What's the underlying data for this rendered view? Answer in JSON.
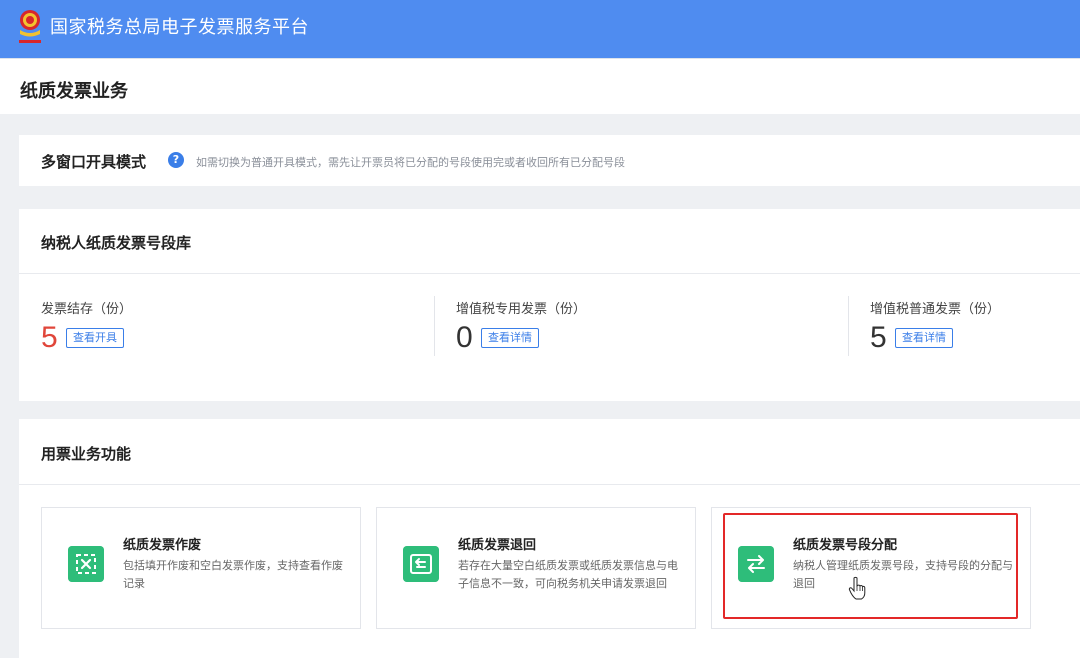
{
  "app": {
    "title": "国家税务总局电子发票服务平台",
    "logo_icon": "tax-emblem-icon"
  },
  "page": {
    "title": "纸质发票业务"
  },
  "mode": {
    "title": "多窗口开具模式",
    "help_icon": "question-circle-icon",
    "note": "如需切换为普通开具模式，需先让开票员将已分配的号段使用完或者收回所有已分配号段"
  },
  "library": {
    "title": "纳税人纸质发票号段库",
    "stats": [
      {
        "label": "发票结存（份）",
        "value": "5",
        "button": "查看开具"
      },
      {
        "label": "增值税专用发票（份）",
        "value": "0",
        "button": "查看详情"
      },
      {
        "label": "增值税普通发票（份）",
        "value": "5",
        "button": "查看详情"
      }
    ]
  },
  "functions": {
    "title": "用票业务功能",
    "items": [
      {
        "name": "纸质发票作废",
        "desc": "包括填开作废和空白发票作废，支持查看作废记录",
        "icon": "void-invoice-icon"
      },
      {
        "name": "纸质发票退回",
        "desc": "若存在大量空白纸质发票或纸质发票信息与电子信息不一致，可向税务机关申请发票退回",
        "icon": "return-invoice-icon"
      },
      {
        "name": "纸质发票号段分配",
        "desc": "纳税人管理纸质发票号段，支持号段的分配与退回",
        "icon": "swap-arrows-icon"
      }
    ]
  },
  "colors": {
    "topbar": "#4f8cf0",
    "accent": "#3a7ee8",
    "stat_red": "#e0463a",
    "function_icon": "#2ebd7a",
    "highlight": "#e32828"
  }
}
